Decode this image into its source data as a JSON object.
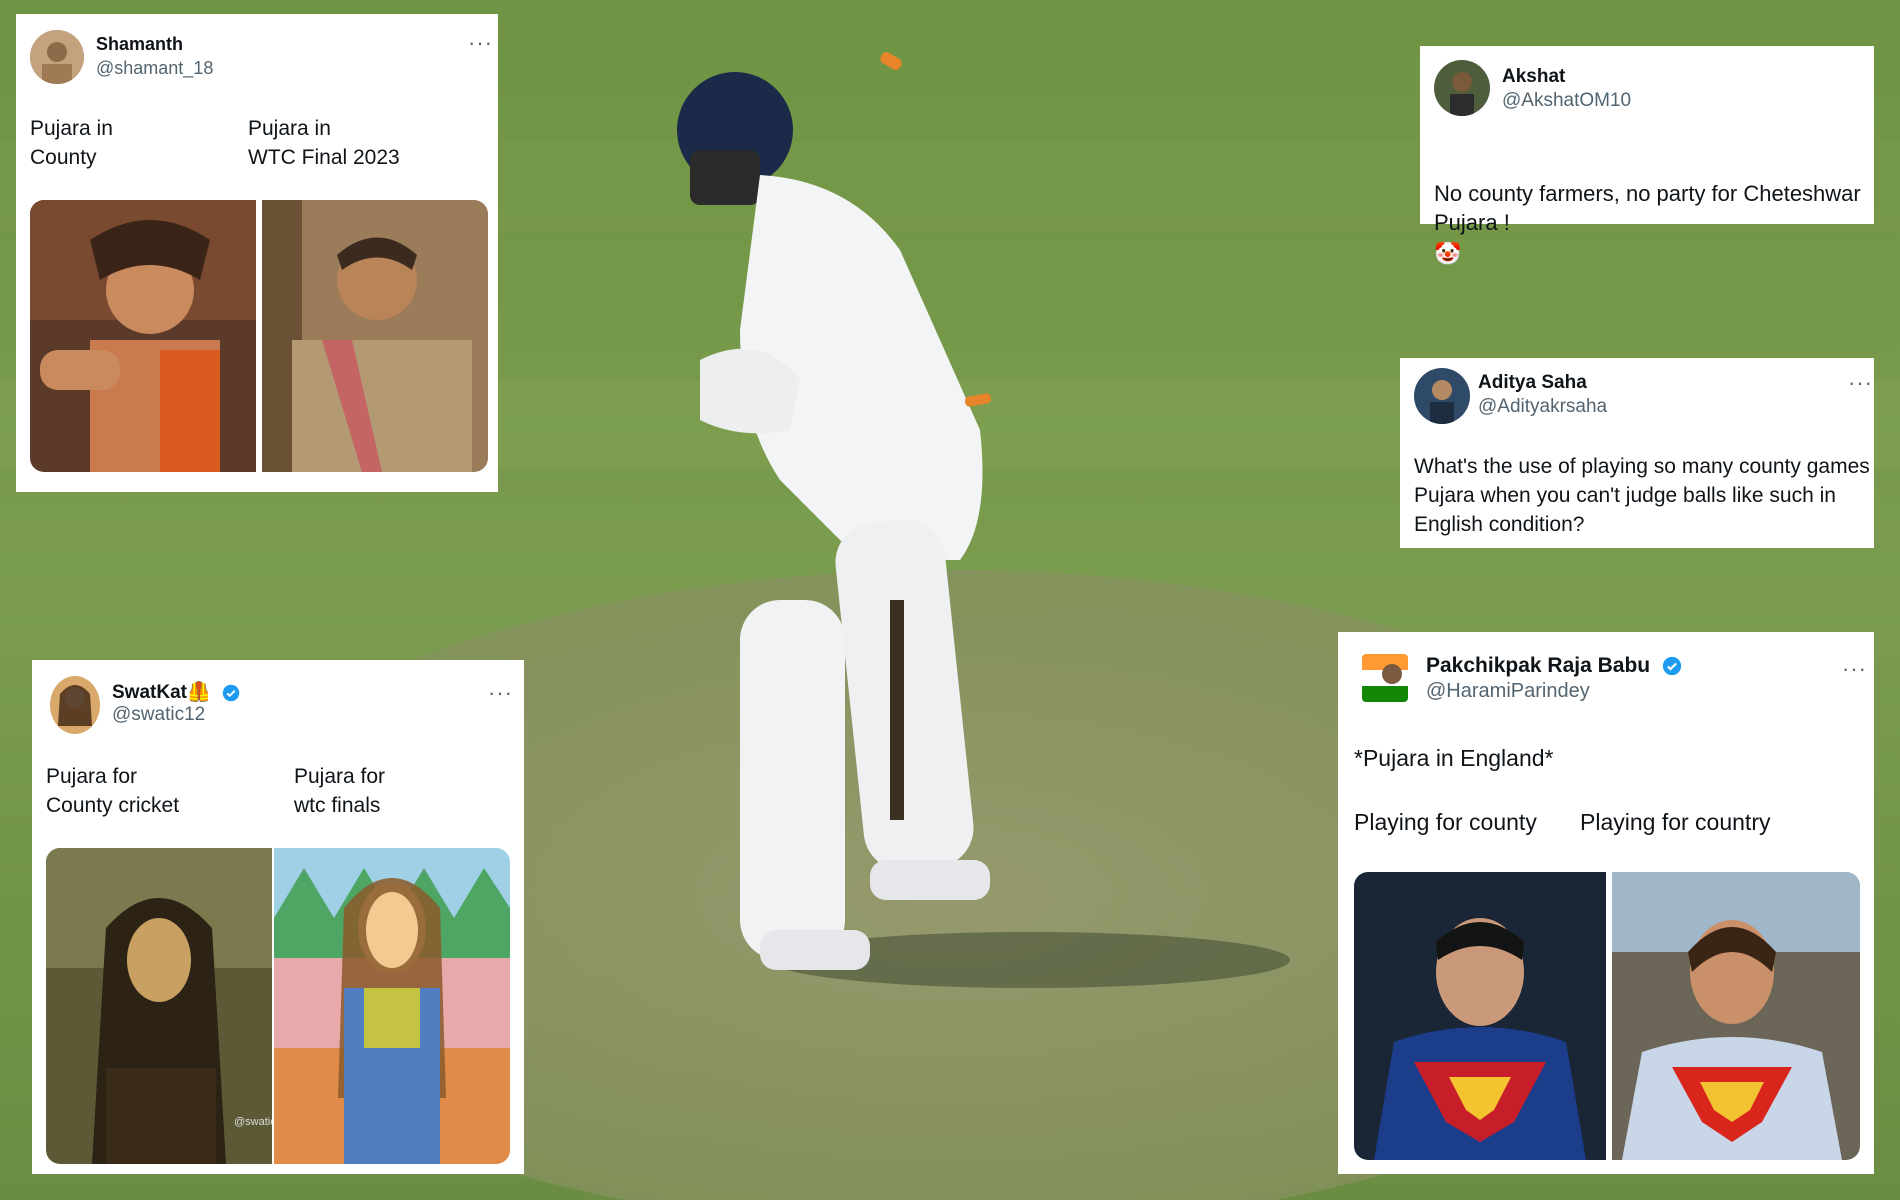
{
  "tweets": [
    {
      "display_name": "Shamanth",
      "handle": "@shamant_18",
      "col1": "Pujara in\nCounty",
      "col2": "Pujara in\nWTC Final 2023",
      "more_icon": "more-horizontal-icon"
    },
    {
      "display_name": "Akshat",
      "handle": "@AkshatOM10",
      "text": "No county farmers, no party for Cheteshwar\nPujara !",
      "emoji": "🤡"
    },
    {
      "display_name": "Aditya Saha",
      "handle": "@Adityakrsaha",
      "text": "What's the use of playing so many county games\nPujara when you can't judge balls like such in\nEnglish condition?",
      "more_icon": "more-horizontal-icon"
    },
    {
      "display_name": "SwatKat",
      "name_emoji": "🦺",
      "handle": "@swatic12",
      "col1": "Pujara for\nCounty cricket",
      "col2": "Pujara for\n  wtc finals",
      "watermark": "@swatic",
      "verified": true,
      "more_icon": "more-horizontal-icon"
    },
    {
      "display_name": "Pakchikpak Raja Babu",
      "handle": "@HaramiParindey",
      "line1": "*Pujara in England*",
      "col1": "Playing for county",
      "col2": "Playing for country",
      "verified": true,
      "more_icon": "more-horizontal-icon"
    }
  ],
  "colors": {
    "pitch": "#7a9b4f",
    "verified": "#1d9bf0"
  }
}
